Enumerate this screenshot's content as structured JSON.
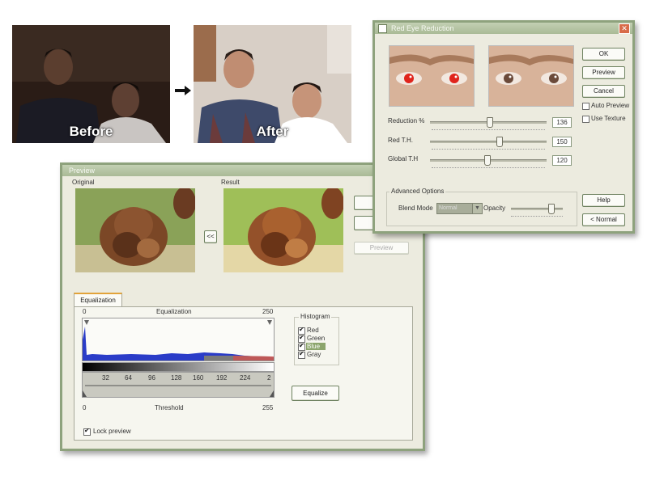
{
  "photos": {
    "before_caption": "Before",
    "after_caption": "After"
  },
  "red_eye_dialog": {
    "title": "Red Eye Reduction",
    "buttons": {
      "ok": "OK",
      "preview": "Preview",
      "cancel": "Cancel",
      "help": "Help",
      "normal": "< Normal"
    },
    "checkboxes": {
      "auto_preview": "Auto Preview",
      "use_texture": "Use Texture"
    },
    "sliders": [
      {
        "label": "Reduction %",
        "value": "136"
      },
      {
        "label": "Red T.H.",
        "value": "150"
      },
      {
        "label": "Global T.H",
        "value": "120"
      }
    ],
    "advanced": {
      "group_label": "Advanced Options",
      "blend_mode_label": "Blend Mode",
      "blend_mode_value": "Normal",
      "opacity_label": "Opacity"
    }
  },
  "preview_dialog": {
    "title": "Preview",
    "original_label": "Original",
    "result_label": "Result",
    "swap_button": "<<",
    "preview_button": "Preview",
    "tab_label": "Equalization",
    "equalization_label": "Equalization",
    "range_min": "0",
    "range_max": "250",
    "threshold_label": "Threshold",
    "threshold_min": "0",
    "threshold_max": "255",
    "scale_ticks": [
      "32",
      "64",
      "96",
      "128",
      "160",
      "192",
      "224",
      "2"
    ],
    "histogram": {
      "label": "Histogram",
      "channels": [
        "Red",
        "Green",
        "Blue",
        "Gray"
      ]
    },
    "equalize_button": "Equalize",
    "lock_preview": "Lock preview"
  },
  "colors": {
    "window_border": "#8ea27d",
    "window_bg": "#ecebdf",
    "histogram_blue": "#2a3cc8"
  }
}
